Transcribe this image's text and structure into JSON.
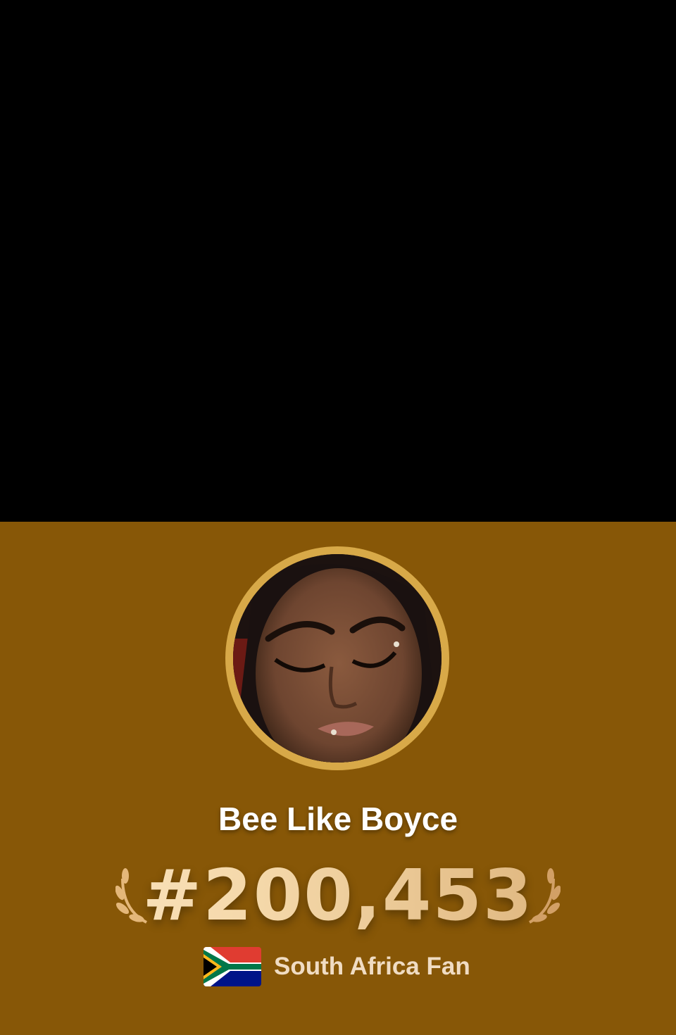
{
  "profile": {
    "display_name": "Bee Like Boyce",
    "rank": "#200,453",
    "fan_label": "South Africa Fan",
    "country_flag_icon": "south-africa-flag-icon",
    "avatar_icon": "profile-photo"
  },
  "colors": {
    "card_background": "#875707",
    "avatar_ring": "#d8a948",
    "rank_gradient_start": "#fde8c6",
    "rank_gradient_end": "#d6a96e",
    "fan_label": "#f0dcc3"
  }
}
